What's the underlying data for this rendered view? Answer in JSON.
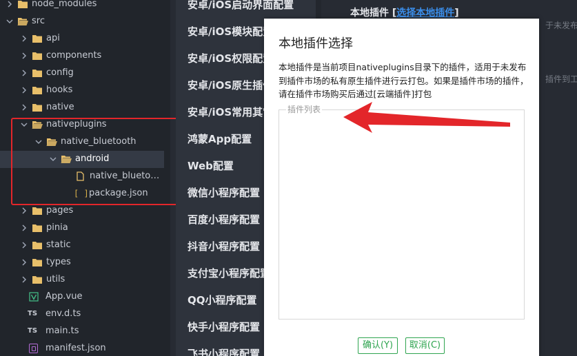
{
  "explorer": {
    "items": [
      {
        "label": "node_modules",
        "type": "folder",
        "expanded": false
      },
      {
        "label": "src",
        "type": "folder",
        "expanded": true
      },
      {
        "label": "api",
        "type": "folder",
        "expanded": false
      },
      {
        "label": "components",
        "type": "folder",
        "expanded": false
      },
      {
        "label": "config",
        "type": "folder",
        "expanded": false
      },
      {
        "label": "hooks",
        "type": "folder",
        "expanded": false
      },
      {
        "label": "native",
        "type": "folder",
        "expanded": false
      },
      {
        "label": "nativeplugins",
        "type": "folder",
        "expanded": true
      },
      {
        "label": "native_bluetooth",
        "type": "folder",
        "expanded": true
      },
      {
        "label": "android",
        "type": "folder",
        "expanded": true,
        "selected": true
      },
      {
        "label": "native_bluetoot...",
        "type": "file"
      },
      {
        "label": "package.json",
        "type": "json"
      },
      {
        "label": "pages",
        "type": "folder",
        "expanded": false
      },
      {
        "label": "pinia",
        "type": "folder",
        "expanded": false
      },
      {
        "label": "static",
        "type": "folder",
        "expanded": false
      },
      {
        "label": "types",
        "type": "folder",
        "expanded": false
      },
      {
        "label": "utils",
        "type": "folder",
        "expanded": false
      },
      {
        "label": "App.vue",
        "type": "vue"
      },
      {
        "label": "env.d.ts",
        "type": "ts"
      },
      {
        "label": "main.ts",
        "type": "ts"
      },
      {
        "label": "manifest.json",
        "type": "manifest"
      }
    ],
    "ts_badge": "TS",
    "json_badge": "[ ]"
  },
  "settings_nav": {
    "items": [
      "安卓/iOS启动界面配置",
      "安卓/iOS模块配置",
      "安卓/iOS权限配置",
      "安卓/iOS原生插件",
      "安卓/iOS常用其它",
      "鸿蒙App配置",
      "Web配置",
      "微信小程序配置",
      "百度小程序配置",
      "抖音小程序配置",
      "支付宝小程序配置",
      "QQ小程序配置",
      "快手小程序配置",
      "飞书小程序配置"
    ]
  },
  "content": {
    "header_prefix": "本地插件 [",
    "header_link": "选择本地插件",
    "header_suffix": "]",
    "faded_right_1": "于未发布到",
    "faded_right_2": "插件到工程中"
  },
  "dialog": {
    "title": "本地插件选择",
    "description": "本地插件是当前项目nativeplugins目录下的插件，适用于未发布到插件市场的私有原生插件进行云打包。如果是插件市场的插件，请在插件市场购买后通过[云端插件]打包",
    "list_legend": "插件列表",
    "ok_label": "确认(Y)",
    "cancel_label": "取消(C)"
  },
  "colors": {
    "accent_green": "#2ea44f",
    "highlight_red": "#e3262a",
    "folder_yellow": "#e8bf6a",
    "link_blue": "#3b8eea"
  }
}
